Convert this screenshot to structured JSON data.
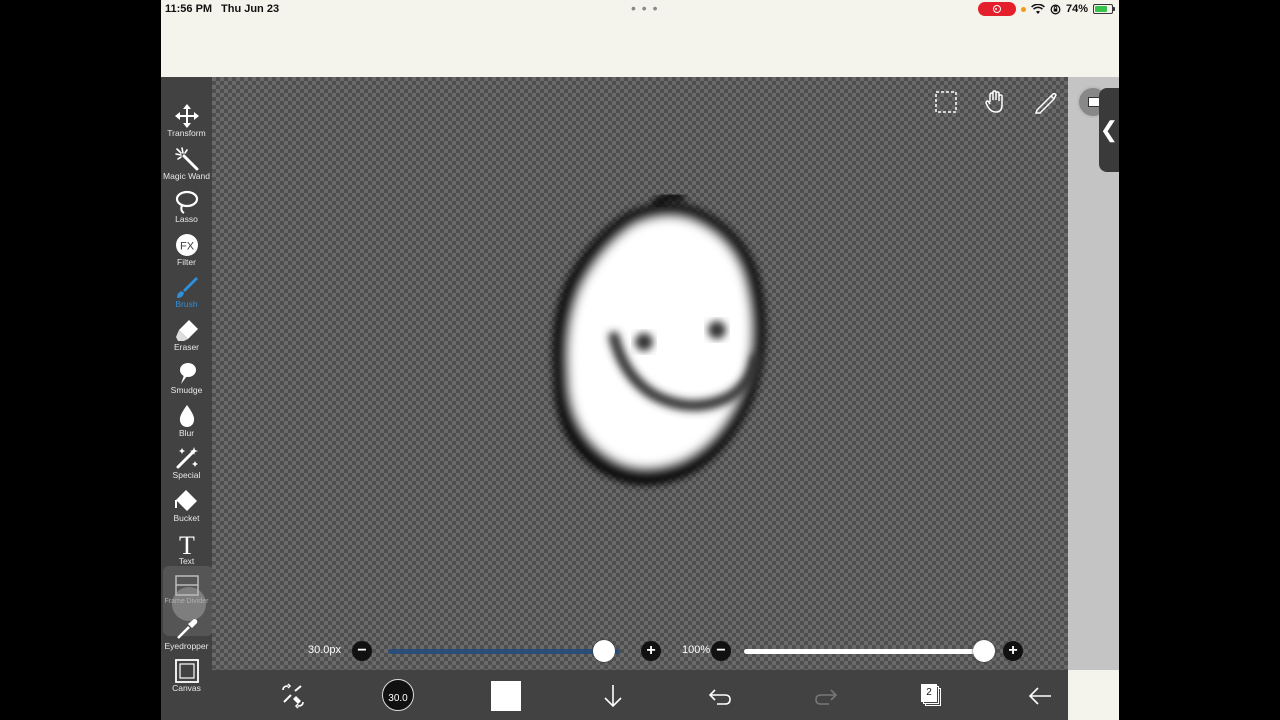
{
  "status_bar": {
    "time": "11:56 PM",
    "date": "Thu Jun 23",
    "battery_percent": "74%",
    "battery_level": 0.74,
    "accent_record": "#e3202b"
  },
  "toolbar": {
    "tools": [
      {
        "label": "Transform",
        "icon": "transform-icon"
      },
      {
        "label": "Magic Wand",
        "icon": "magic-wand-icon"
      },
      {
        "label": "Lasso",
        "icon": "lasso-icon"
      },
      {
        "label": "Filter",
        "icon": "filter-fx-icon",
        "glyph": "FX"
      },
      {
        "label": "Brush",
        "icon": "brush-icon",
        "active": true
      },
      {
        "label": "Eraser",
        "icon": "eraser-icon"
      },
      {
        "label": "Smudge",
        "icon": "smudge-icon"
      },
      {
        "label": "Blur",
        "icon": "blur-drop-icon"
      },
      {
        "label": "Special",
        "icon": "special-wand-icon"
      },
      {
        "label": "Bucket",
        "icon": "bucket-icon"
      },
      {
        "label": "Text",
        "icon": "text-icon",
        "glyph": "T"
      },
      {
        "label": "Frame Divider",
        "icon": "frame-divider-icon"
      },
      {
        "label": "Eyedropper",
        "icon": "eyedropper-icon"
      },
      {
        "label": "Canvas",
        "icon": "canvas-icon"
      }
    ],
    "active_color": "#2e8fdc"
  },
  "canvas_top_icons": [
    "selection-icon",
    "hand-icon",
    "ruler-pen-icon"
  ],
  "sliders": {
    "brush_size_label": "30.0px",
    "brush_size_fraction": 0.93,
    "opacity_label": "100%",
    "opacity_fraction": 1.0,
    "minus": "−",
    "plus": "+"
  },
  "bottom_bar": {
    "brush_size_value": "30.0",
    "current_color": "#ffffff",
    "layer_count": "2"
  }
}
